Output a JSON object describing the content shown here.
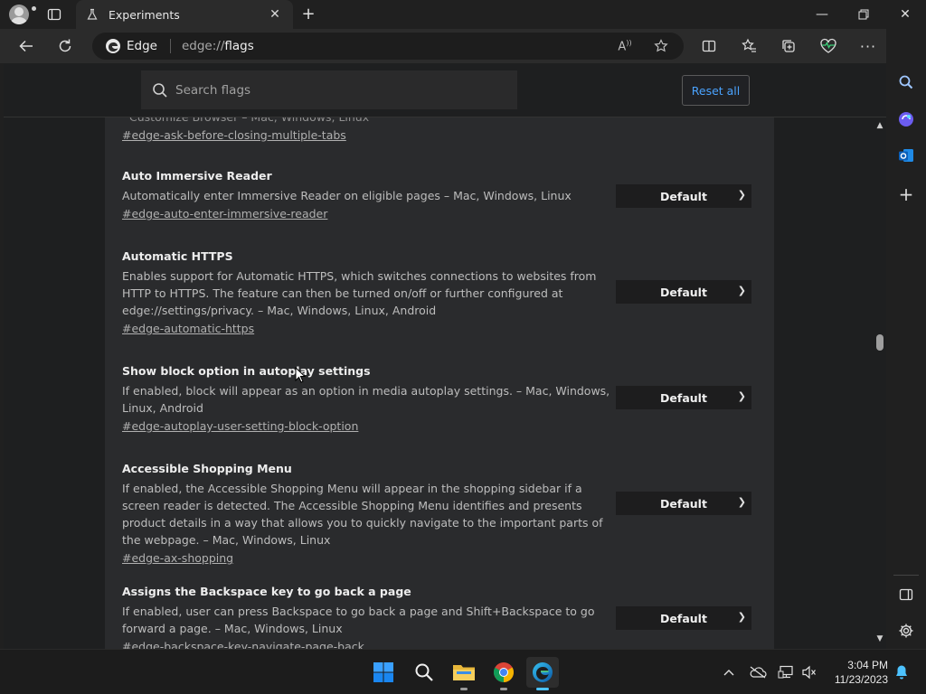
{
  "tab": {
    "title": "Experiments"
  },
  "omnibox": {
    "edge_label": "Edge",
    "url_prefix": "edge://",
    "url_path": "flags"
  },
  "page": {
    "search_placeholder": "Search flags",
    "reset_label": "Reset all",
    "experiments": [
      {
        "title": "",
        "desc": "Customize Browser – Mac, Windows, Linux",
        "link": "#edge-ask-before-closing-multiple-tabs",
        "select": ""
      },
      {
        "title": "Auto Immersive Reader",
        "desc": "Automatically enter Immersive Reader on eligible pages – Mac, Windows, Linux",
        "link": "#edge-auto-enter-immersive-reader",
        "select": "Default"
      },
      {
        "title": "Automatic HTTPS",
        "desc": "Enables support for Automatic HTTPS, which switches connections to websites from HTTP to HTTPS. The feature can then be turned on/off or further configured at edge://settings/privacy. – Mac, Windows, Linux, Android",
        "link": "#edge-automatic-https",
        "select": "Default"
      },
      {
        "title": "Show block option in autoplay settings",
        "desc": "If enabled, block will appear as an option in media autoplay settings. – Mac, Windows, Linux, Android",
        "link": "#edge-autoplay-user-setting-block-option",
        "select": "Default"
      },
      {
        "title": "Accessible Shopping Menu",
        "desc": "If enabled, the Accessible Shopping Menu will appear in the shopping sidebar if a screen reader is detected. The Accessible Shopping Menu identifies and presents product details in a way that allows you to quickly navigate to the important parts of the webpage. – Mac, Windows, Linux",
        "link": "#edge-ax-shopping",
        "select": "Default"
      },
      {
        "title": "Assigns the Backspace key to go back a page",
        "desc": "If enabled, user can press Backspace to go back a page and Shift+Backspace to go forward a page. – Mac, Windows, Linux",
        "link": "#edge-backspace-key-navigate-page-back",
        "select": "Default"
      }
    ]
  },
  "clock": {
    "time": "3:04 PM",
    "date": "11/23/2023"
  }
}
